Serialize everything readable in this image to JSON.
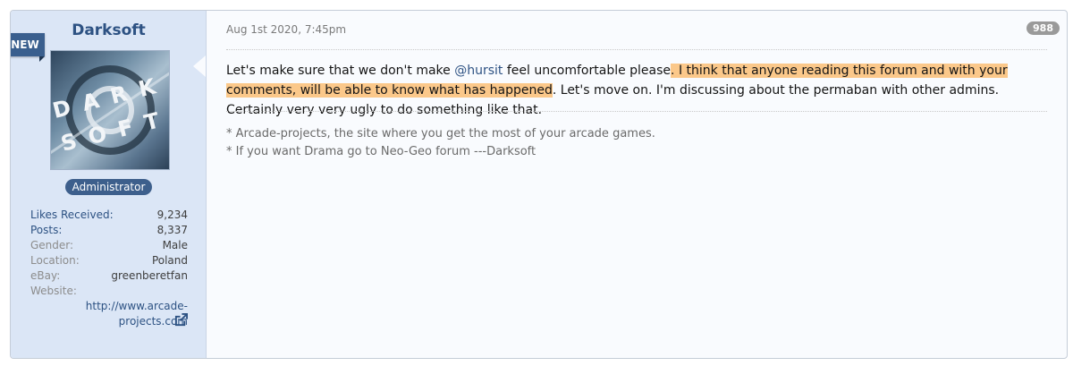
{
  "user": {
    "name": "Darksoft",
    "ribbon": "NEW",
    "role": "Administrator",
    "avatar_text_top": "DARK",
    "avatar_text_bottom": "SOFT"
  },
  "stats": [
    {
      "label": "Likes Received:",
      "value": "9,234"
    },
    {
      "label": "Posts:",
      "value": "8,337"
    },
    {
      "label": "Gender:",
      "value": "Male"
    },
    {
      "label": "Location:",
      "value": "Poland"
    },
    {
      "label": "eBay:",
      "value": "greenberetfan"
    }
  ],
  "website": {
    "label": "Website:",
    "url": "http://www.arcade-projects.com"
  },
  "post": {
    "date": "Aug 1st 2020, 7:45pm",
    "number": "988",
    "msg_part1": "Let's make sure that we don't make ",
    "mention": "@hursit",
    "msg_part2": " feel uncomfortable please",
    "msg_highlight": ". I think that anyone reading this forum and with your comments, will be able to know what has happened",
    "msg_part3": ". Let's move on. I'm discussing about the permaban with other admins. Certainly very very ugly to do something like that."
  },
  "signature": {
    "line1": "* Arcade-projects, the site where you get the most of your arcade games.",
    "line2": "* If you want Drama go to Neo-Geo forum ---Darksoft"
  },
  "colors": {
    "accent": "#2d5283",
    "highlight": "#fbc88a",
    "sidebar": "#dbe6f6"
  },
  "icons": {
    "external": "external-link-icon"
  }
}
